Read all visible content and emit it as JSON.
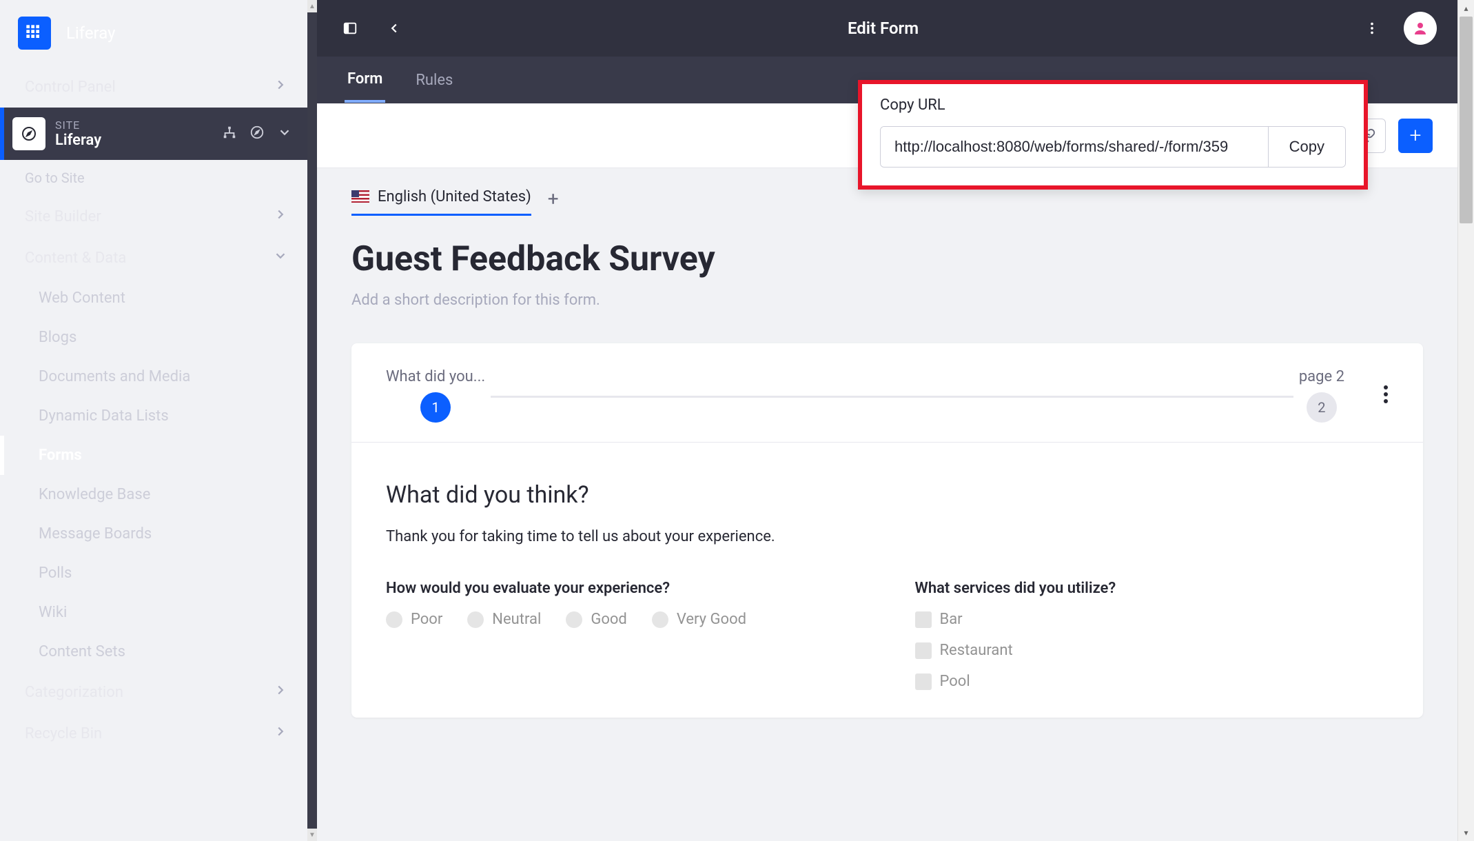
{
  "brand": {
    "name": "Liferay"
  },
  "sidebar": {
    "control_panel": "Control Panel",
    "site_label": "SITE",
    "site_name": "Liferay",
    "go_to_site": "Go to Site",
    "site_builder": "Site Builder",
    "content_data": "Content & Data",
    "items": [
      "Web Content",
      "Blogs",
      "Documents and Media",
      "Dynamic Data Lists",
      "Forms",
      "Knowledge Base",
      "Message Boards",
      "Polls",
      "Wiki",
      "Content Sets"
    ],
    "categorization": "Categorization",
    "recycle_bin": "Recycle Bin"
  },
  "header": {
    "title": "Edit Form",
    "tabs": {
      "form": "Form",
      "rules": "Rules"
    }
  },
  "copy_url": {
    "title": "Copy URL",
    "value": "http://localhost:8080/web/forms/shared/-/form/359",
    "button": "Copy"
  },
  "language": {
    "label": "English (United States)"
  },
  "form": {
    "title": "Guest Feedback Survey",
    "description_placeholder": "Add a short description for this form."
  },
  "pager": {
    "page1_label": "What did you...",
    "page1_num": "1",
    "page2_label": "page 2",
    "page2_num": "2"
  },
  "page": {
    "title": "What did you think?",
    "subtitle": "Thank you for taking time to tell us about your experience.",
    "q1": {
      "label": "How would you evaluate your experience?",
      "opts": [
        "Poor",
        "Neutral",
        "Good",
        "Very Good"
      ]
    },
    "q2": {
      "label": "What services did you utilize?",
      "opts": [
        "Bar",
        "Restaurant",
        "Pool"
      ]
    }
  }
}
